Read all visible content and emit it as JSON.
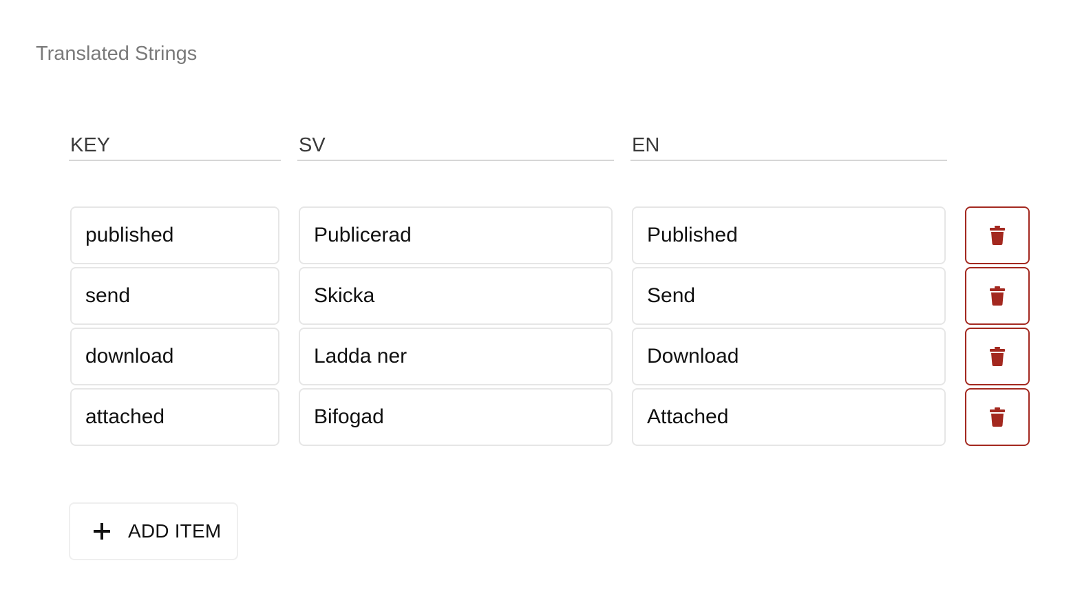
{
  "section": {
    "title": "Translated Strings"
  },
  "columns": {
    "key": "KEY",
    "sv": "SV",
    "en": "EN"
  },
  "rows": [
    {
      "key": "published",
      "sv": "Publicerad",
      "en": "Published"
    },
    {
      "key": "send",
      "sv": "Skicka",
      "en": "Send"
    },
    {
      "key": "download",
      "sv": "Ladda ner",
      "en": "Download"
    },
    {
      "key": "attached",
      "sv": "Bifogad",
      "en": "Attached"
    }
  ],
  "icons": {
    "delete": "trash-icon",
    "add": "plus-icon"
  },
  "colors": {
    "danger": "#a3281f",
    "title": "#7a7a7a",
    "border": "#e6e6e6"
  },
  "add_button": {
    "label": "ADD ITEM"
  }
}
